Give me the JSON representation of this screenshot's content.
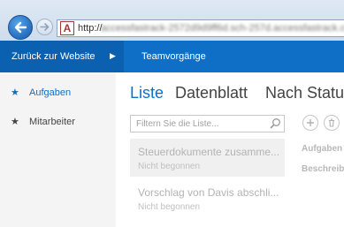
{
  "browser": {
    "back_icon": "back-arrow-icon",
    "forward_icon": "forward-arrow-icon",
    "address_prefix": "http://",
    "address_url": "accessfastrack-2572d9d9ff6d.sch-257d.accessfastrack.com",
    "site_icon_letter": "A"
  },
  "app": {
    "back_to_site_label": "Zurück zur Website",
    "back_arrow_glyph": "▶",
    "title": "Teamvorgänge",
    "bar_color": "#0f6fc6"
  },
  "sidebar": {
    "items": [
      {
        "label": "Aufgaben",
        "icon": "star-icon",
        "active": true
      },
      {
        "label": "Mitarbeiter",
        "icon": "star-icon",
        "active": false
      }
    ]
  },
  "views": {
    "tabs": [
      {
        "label": "Liste",
        "active": true
      },
      {
        "label": "Datenblatt",
        "active": false
      },
      {
        "label": "Nach Status",
        "active": false
      }
    ]
  },
  "search": {
    "placeholder": "Filtern Sie die Liste...",
    "value": ""
  },
  "list": {
    "items": [
      {
        "title": "Steuerdokumente zusamme...",
        "status": "Nicht begonnen"
      },
      {
        "title": "Vorschlag von Davis abschli...",
        "status": "Nicht begonnen"
      }
    ]
  },
  "actions": {
    "add_icon": "plus-icon",
    "delete_icon": "trash-icon"
  },
  "form": {
    "labels": [
      "Aufgaben",
      "Beschreib"
    ]
  }
}
